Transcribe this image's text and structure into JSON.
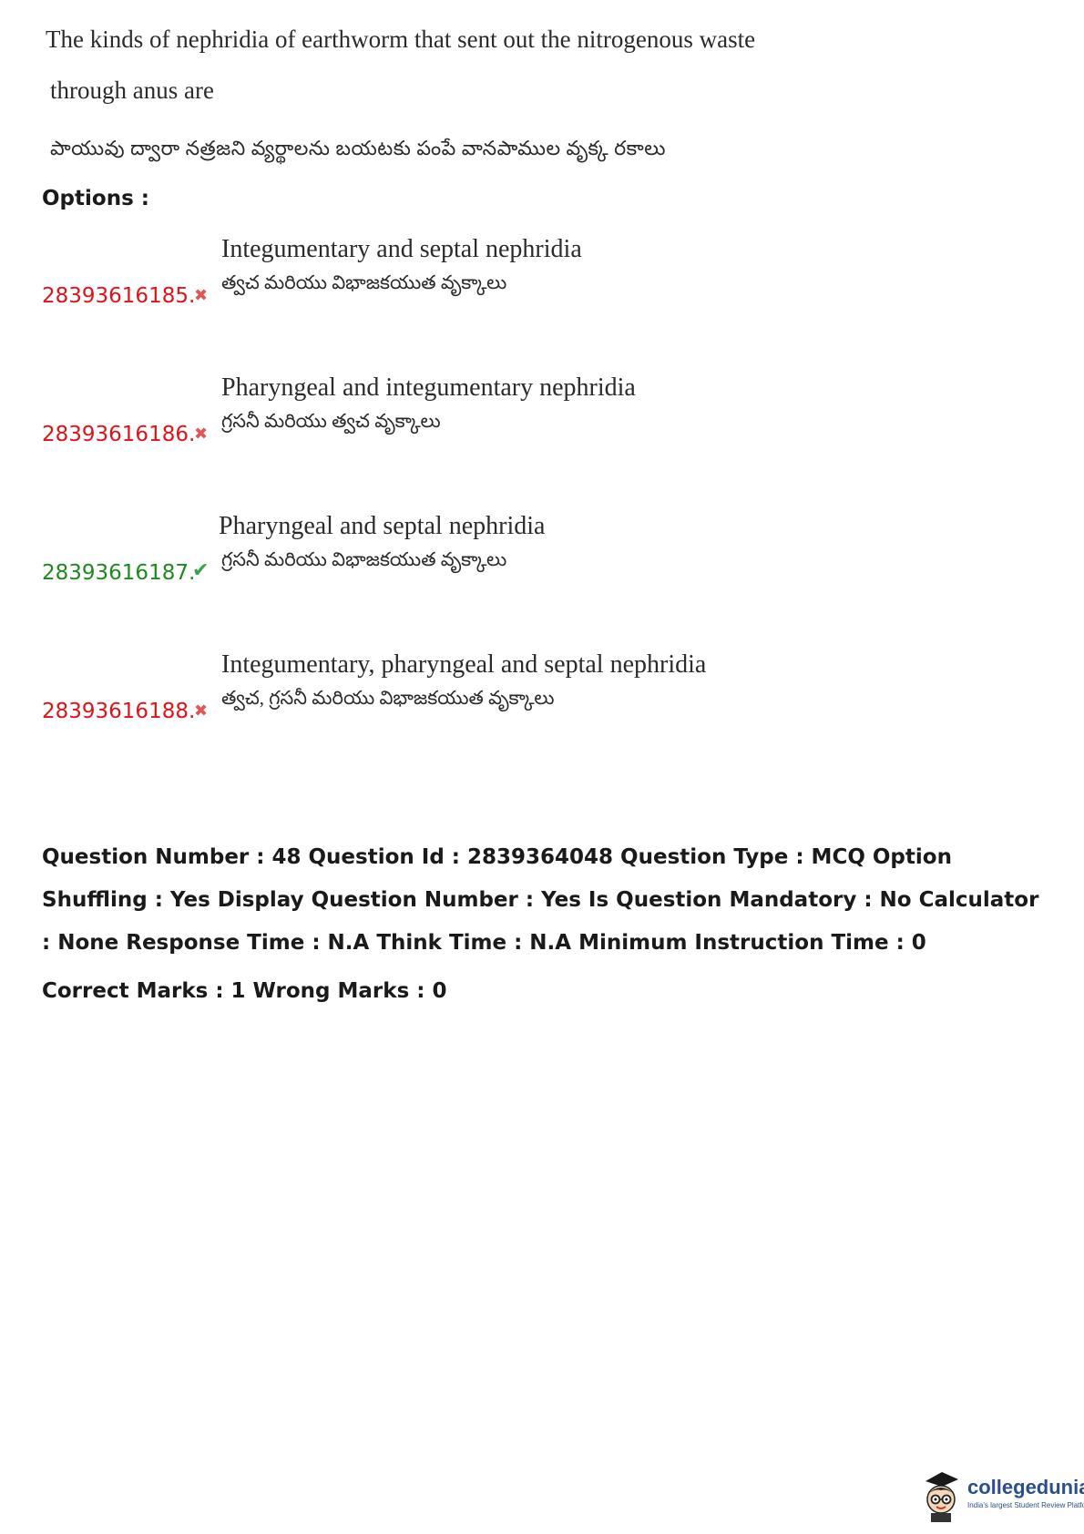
{
  "question": {
    "line1": "The kinds of nephridia of earthworm that sent out the nitrogenous waste",
    "line2": "through anus are",
    "telugu": "పాయువు ద్వారా నత్రజని వ్యర్థాలను బయటకు పంపే వానపాముల వృక్క రకాలు"
  },
  "options_label": "Options :",
  "options": [
    {
      "id": "28393616185.",
      "status": "wrong",
      "en": "Integumentary and septal nephridia",
      "te": "త్వచ మరియు విభాజకయుత వృక్కాలు"
    },
    {
      "id": "28393616186.",
      "status": "wrong",
      "en": "Pharyngeal and integumentary nephridia",
      "te": "గ్రసనీ మరియు త్వచ వృక్కాలు"
    },
    {
      "id": "28393616187.",
      "status": "correct",
      "en": "Pharyngeal and septal nephridia",
      "te": "గ్రసనీ మరియు విభాజకయుత వృక్కాలు"
    },
    {
      "id": "28393616188.",
      "status": "wrong",
      "en": "Integumentary, pharyngeal and septal nephridia",
      "te": "త్వచ, గ్రసనీ మరియు విభాజకయుత వృక్కాలు"
    }
  ],
  "icons": {
    "wrong": "cross-icon",
    "correct": "check-icon"
  },
  "colors": {
    "wrong": "#e0131a",
    "correct": "#1e8a1e",
    "brand": "#2c4f8a"
  },
  "meta": {
    "text": "Question Number : 48 Question Id : 2839364048 Question Type : MCQ Option Shuffling : Yes Display Question Number : Yes Is Question Mandatory : No Calculator : None Response Time : N.A Think Time : N.A Minimum Instruction Time : 0",
    "marks": "Correct Marks : 1 Wrong Marks : 0"
  },
  "logo": {
    "name": "collegedunia",
    "tagline": "India's largest Student Review Platform"
  }
}
